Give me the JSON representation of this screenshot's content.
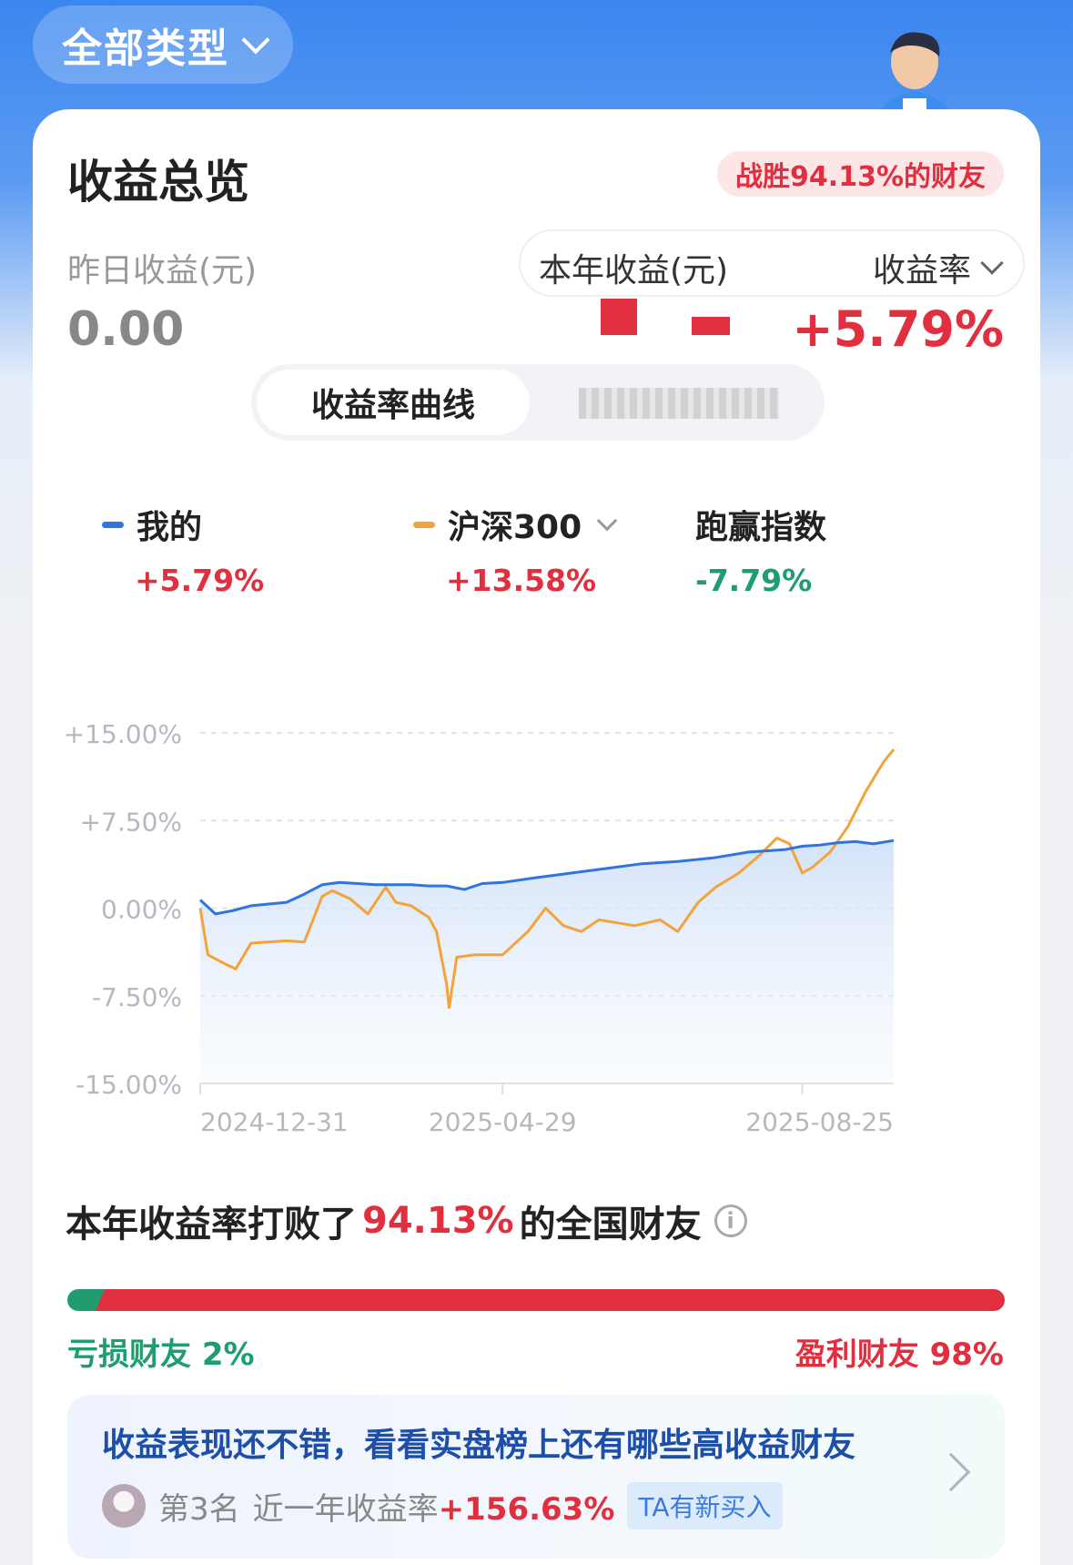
{
  "header": {
    "type_selector": "全部类型"
  },
  "summary": {
    "title": "收益总览",
    "beat_badge": "战胜94.13%的财友",
    "yesterday_label": "昨日收益(元)",
    "yesterday_value": "0.00",
    "year_label": "本年收益(元)",
    "rate_selector": "收益率",
    "rate_value": "+5.79%"
  },
  "tabs": {
    "active": "收益率曲线"
  },
  "legend": {
    "mine_name": "我的",
    "mine_value": "+5.79%",
    "index_name": "沪深300",
    "index_value": "+13.58%",
    "excess_name": "跑赢指数",
    "excess_value": "-7.79%"
  },
  "colors": {
    "mine": "#2f74e0",
    "index": "#f2a33a",
    "positive": "#e0303f",
    "negative": "#1f9d6e"
  },
  "chart_data": {
    "type": "line",
    "x_ticks": [
      "2024-12-31",
      "2025-04-29",
      "2025-08-25"
    ],
    "y_ticks": [
      "+15.00%",
      "+7.50%",
      "0.00%",
      "-7.50%",
      "-15.00%"
    ],
    "ylim": [
      -15,
      15
    ],
    "grid": true,
    "series": [
      {
        "name": "我的",
        "color": "#2f74e0",
        "x": [
          "2024-12-31",
          "2025-01-06",
          "2025-01-13",
          "2025-01-20",
          "2025-02-03",
          "2025-02-10",
          "2025-02-17",
          "2025-02-24",
          "2025-03-03",
          "2025-03-10",
          "2025-03-17",
          "2025-03-24",
          "2025-03-31",
          "2025-04-07",
          "2025-04-14",
          "2025-04-21",
          "2025-04-29",
          "2025-05-12",
          "2025-05-26",
          "2025-06-09",
          "2025-06-23",
          "2025-07-07",
          "2025-07-21",
          "2025-08-04",
          "2025-08-18",
          "2025-08-25",
          "2025-09-01",
          "2025-09-08",
          "2025-09-15",
          "2025-09-22",
          "2025-09-30"
        ],
        "values": [
          0.7,
          -0.5,
          -0.2,
          0.2,
          0.5,
          1.2,
          2.0,
          2.2,
          2.1,
          2.0,
          2.0,
          2.0,
          1.9,
          1.9,
          1.6,
          2.1,
          2.2,
          2.6,
          3.0,
          3.4,
          3.8,
          4.0,
          4.3,
          4.8,
          5.0,
          5.3,
          5.4,
          5.6,
          5.7,
          5.5,
          5.79
        ]
      },
      {
        "name": "沪深300",
        "color": "#f2a33a",
        "x": [
          "2024-12-31",
          "2025-01-03",
          "2025-01-10",
          "2025-01-14",
          "2025-01-20",
          "2025-02-03",
          "2025-02-10",
          "2025-02-17",
          "2025-02-21",
          "2025-02-28",
          "2025-03-07",
          "2025-03-14",
          "2025-03-18",
          "2025-03-24",
          "2025-03-31",
          "2025-04-03",
          "2025-04-07",
          "2025-04-08",
          "2025-04-11",
          "2025-04-18",
          "2025-04-29",
          "2025-05-09",
          "2025-05-16",
          "2025-05-23",
          "2025-05-30",
          "2025-06-06",
          "2025-06-20",
          "2025-06-30",
          "2025-07-07",
          "2025-07-15",
          "2025-07-22",
          "2025-07-31",
          "2025-08-08",
          "2025-08-15",
          "2025-08-20",
          "2025-08-25",
          "2025-08-29",
          "2025-09-05",
          "2025-09-12",
          "2025-09-19",
          "2025-09-26",
          "2025-09-30"
        ],
        "values": [
          0.0,
          -4.0,
          -4.8,
          -5.2,
          -3.0,
          -2.8,
          -2.9,
          1.0,
          1.5,
          0.8,
          -0.5,
          1.8,
          0.5,
          0.2,
          -0.8,
          -2.0,
          -6.5,
          -8.5,
          -4.2,
          -4.0,
          -4.0,
          -2.0,
          0.0,
          -1.5,
          -2.0,
          -1.0,
          -1.5,
          -1.0,
          -2.0,
          0.5,
          1.8,
          3.0,
          4.5,
          6.0,
          5.5,
          3.0,
          3.5,
          4.8,
          7.0,
          10.0,
          12.5,
          13.58
        ]
      }
    ]
  },
  "ranking": {
    "prefix": "本年收益率打败了",
    "percent": "94.13%",
    "suffix": "的全国财友",
    "info_icon": "info-icon",
    "loss_share": 2,
    "gain_share": 98,
    "loss_label": "亏损财友 2%",
    "gain_label": "盈利财友 98%"
  },
  "promo": {
    "title": "收益表现还不错，看看实盘榜上还有哪些高收益财友",
    "rank": "第3名",
    "period_label": "近一年收益率",
    "return_value": "+156.63%",
    "tag": "TA有新买入"
  }
}
